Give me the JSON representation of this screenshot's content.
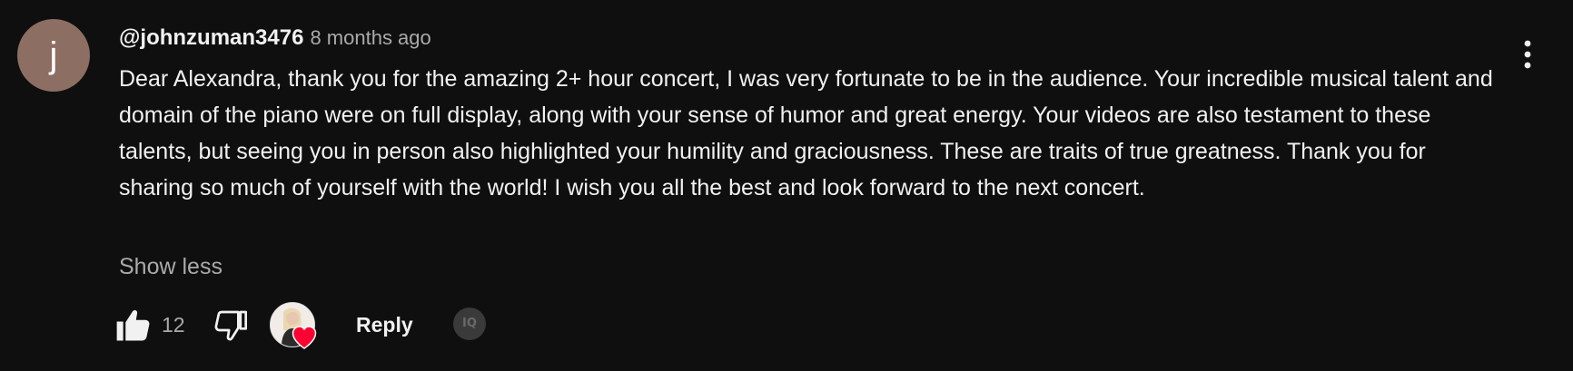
{
  "comment": {
    "avatar_letter": "j",
    "avatar_color": "#8d6e63",
    "author": "@johnzuman3476",
    "time": "8 months ago",
    "text": "Dear Alexandra, thank you for the amazing 2+ hour concert, I was very fortunate to be in the audience. Your incredible musical talent and domain of the piano were on full display, along with your sense of humor and great energy. Your videos are also testament to these talents, but seeing you in person also highlighted your humility and graciousness. These are traits of true greatness. Thank you for sharing so much of yourself with the world! I wish you all the best and look forward to the next concert.",
    "show_less_label": "Show less"
  },
  "actions": {
    "like_icon": "thumbs-up-icon",
    "like_count": "12",
    "dislike_icon": "thumbs-down-icon",
    "creator_heart_icon": "heart-icon",
    "heart_color": "#ff0033",
    "reply_label": "Reply",
    "extension_icon_text": "IQ"
  },
  "menu": {
    "icon": "more-vertical-icon"
  },
  "colors": {
    "background": "#0f0f0f",
    "primary_text": "#f1f1f1",
    "secondary_text": "#aaaaaa"
  }
}
